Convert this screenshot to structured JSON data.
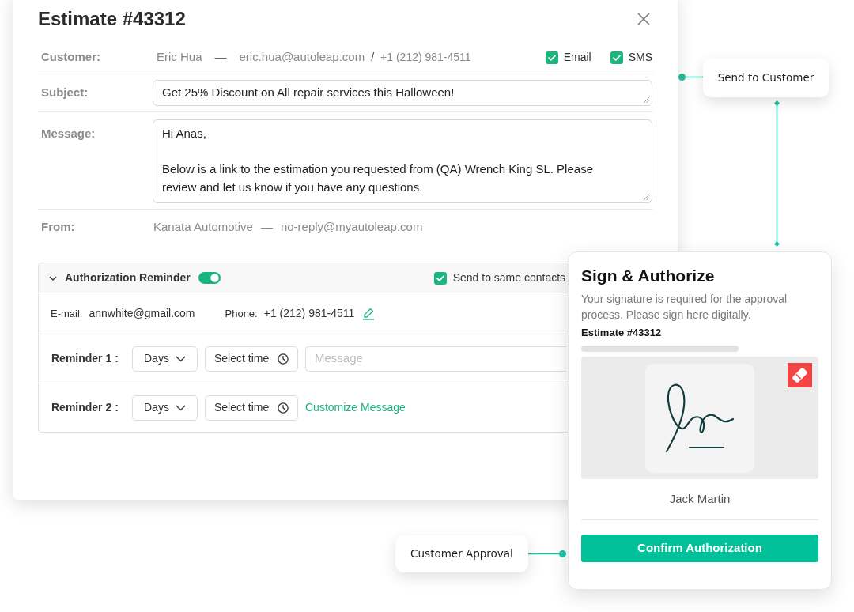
{
  "dialog": {
    "title": "Estimate #43312",
    "fields": [
      {
        "kind": "contact",
        "label": "Customer:",
        "name": "Eric Hua",
        "separator": "—",
        "email": "eric.hua@autoleap.com",
        "divider": "/",
        "phone": "+1 (212) 981-4511",
        "channels": [
          {
            "label": "Email",
            "checked": true
          },
          {
            "label": "SMS",
            "checked": true
          }
        ]
      },
      {
        "kind": "input",
        "label": "Subject:",
        "value": "Get 25% Discount on All repair services this Halloween!"
      },
      {
        "kind": "textarea",
        "label": "Message:",
        "value": "Hi Anas,\n\nBelow is a link to the estimation you requested from (QA) Wrench King SL. Please review and let us know if you have any questions."
      },
      {
        "kind": "sender",
        "label": "From:",
        "name": "Kanata Automotive",
        "separator": "—",
        "email": "no-reply@myautoleap.com"
      }
    ],
    "reminder_section": {
      "title": "Authorization Reminder",
      "expanded": true,
      "on": true,
      "same_contacts": {
        "label": "Send to same contacts",
        "checked": true
      },
      "contact": {
        "email_label": "E-mail:",
        "email": "annwhite@gmail.com",
        "phone_label": "Phone:",
        "phone": "+1 (212) 981-4511"
      },
      "reminders": [
        {
          "kind": "message-field",
          "label": "Reminder 1 :",
          "interval": "Days",
          "time": "Select time",
          "placeholder": "Message"
        },
        {
          "kind": "link",
          "label": "Reminder 2 :",
          "interval": "Days",
          "time": "Select time",
          "link": "Customize Message"
        }
      ]
    }
  },
  "callouts": [
    {
      "label": "Send to Customer"
    },
    {
      "label": "Customer Approval"
    }
  ],
  "sign_card": {
    "title": "Sign & Authorize",
    "description": "Your signature is required for the approval process. Please sign here digitally.",
    "estimate": "Estimate #43312",
    "signer": "Jack Martin",
    "button": "Confirm Authorization"
  }
}
